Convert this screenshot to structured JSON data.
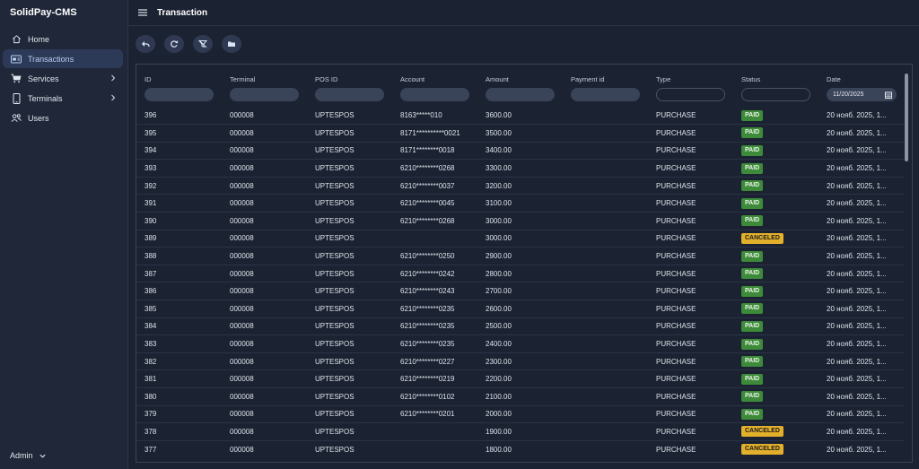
{
  "app": {
    "brand": "SolidPay-CMS",
    "user": "Admin"
  },
  "header": {
    "title": "Transaction"
  },
  "sidebar": {
    "items": [
      {
        "label": "Home",
        "icon": "home-icon",
        "active": false,
        "has_children": false
      },
      {
        "label": "Transactions",
        "icon": "card-icon",
        "active": true,
        "has_children": false
      },
      {
        "label": "Services",
        "icon": "cart-icon",
        "active": false,
        "has_children": true
      },
      {
        "label": "Terminals",
        "icon": "phone-icon",
        "active": false,
        "has_children": true
      },
      {
        "label": "Users",
        "icon": "users-icon",
        "active": false,
        "has_children": false
      }
    ]
  },
  "toolbar": {
    "buttons": [
      "back-icon",
      "refresh-icon",
      "filter-clear-icon",
      "folder-icon"
    ]
  },
  "table": {
    "columns": [
      "ID",
      "Terminal",
      "POS ID",
      "Account",
      "Amount",
      "Payment id",
      "Type",
      "Status",
      "Date"
    ],
    "date_filter": "11/20/2025",
    "rows": [
      [
        "396",
        "000008",
        "UPTESPOS",
        "8163*****010",
        "3600.00",
        "",
        "PURCHASE",
        "PAID",
        "20 нояб. 2025, 1..."
      ],
      [
        "395",
        "000008",
        "UPTESPOS",
        "8171**********0021",
        "3500.00",
        "",
        "PURCHASE",
        "PAID",
        "20 нояб. 2025, 1..."
      ],
      [
        "394",
        "000008",
        "UPTESPOS",
        "8171********0018",
        "3400.00",
        "",
        "PURCHASE",
        "PAID",
        "20 нояб. 2025, 1..."
      ],
      [
        "393",
        "000008",
        "UPTESPOS",
        "6210********0268",
        "3300.00",
        "",
        "PURCHASE",
        "PAID",
        "20 нояб. 2025, 1..."
      ],
      [
        "392",
        "000008",
        "UPTESPOS",
        "6210********0037",
        "3200.00",
        "",
        "PURCHASE",
        "PAID",
        "20 нояб. 2025, 1..."
      ],
      [
        "391",
        "000008",
        "UPTESPOS",
        "6210********0045",
        "3100.00",
        "",
        "PURCHASE",
        "PAID",
        "20 нояб. 2025, 1..."
      ],
      [
        "390",
        "000008",
        "UPTESPOS",
        "6210********0268",
        "3000.00",
        "",
        "PURCHASE",
        "PAID",
        "20 нояб. 2025, 1..."
      ],
      [
        "389",
        "000008",
        "UPTESPOS",
        "",
        "3000.00",
        "",
        "PURCHASE",
        "CANCELED",
        "20 нояб. 2025, 1..."
      ],
      [
        "388",
        "000008",
        "UPTESPOS",
        "6210********0250",
        "2900.00",
        "",
        "PURCHASE",
        "PAID",
        "20 нояб. 2025, 1..."
      ],
      [
        "387",
        "000008",
        "UPTESPOS",
        "6210********0242",
        "2800.00",
        "",
        "PURCHASE",
        "PAID",
        "20 нояб. 2025, 1..."
      ],
      [
        "386",
        "000008",
        "UPTESPOS",
        "6210********0243",
        "2700.00",
        "",
        "PURCHASE",
        "PAID",
        "20 нояб. 2025, 1..."
      ],
      [
        "385",
        "000008",
        "UPTESPOS",
        "6210********0235",
        "2600.00",
        "",
        "PURCHASE",
        "PAID",
        "20 нояб. 2025, 1..."
      ],
      [
        "384",
        "000008",
        "UPTESPOS",
        "6210********0235",
        "2500.00",
        "",
        "PURCHASE",
        "PAID",
        "20 нояб. 2025, 1..."
      ],
      [
        "383",
        "000008",
        "UPTESPOS",
        "6210********0235",
        "2400.00",
        "",
        "PURCHASE",
        "PAID",
        "20 нояб. 2025, 1..."
      ],
      [
        "382",
        "000008",
        "UPTESPOS",
        "6210********0227",
        "2300.00",
        "",
        "PURCHASE",
        "PAID",
        "20 нояб. 2025, 1..."
      ],
      [
        "381",
        "000008",
        "UPTESPOS",
        "6210********0219",
        "2200.00",
        "",
        "PURCHASE",
        "PAID",
        "20 нояб. 2025, 1..."
      ],
      [
        "380",
        "000008",
        "UPTESPOS",
        "6210********0102",
        "2100.00",
        "",
        "PURCHASE",
        "PAID",
        "20 нояб. 2025, 1..."
      ],
      [
        "379",
        "000008",
        "UPTESPOS",
        "6210********0201",
        "2000.00",
        "",
        "PURCHASE",
        "PAID",
        "20 нояб. 2025, 1..."
      ],
      [
        "378",
        "000008",
        "UPTESPOS",
        "",
        "1900.00",
        "",
        "PURCHASE",
        "CANCELED",
        "20 нояб. 2025, 1..."
      ],
      [
        "377",
        "000008",
        "UPTESPOS",
        "",
        "1800.00",
        "",
        "PURCHASE",
        "CANCELED",
        "20 нояб. 2025, 1..."
      ]
    ]
  },
  "colors": {
    "paid": "#3d8a3a",
    "canceled": "#e3b02b",
    "active_nav": "#2d3a57"
  }
}
